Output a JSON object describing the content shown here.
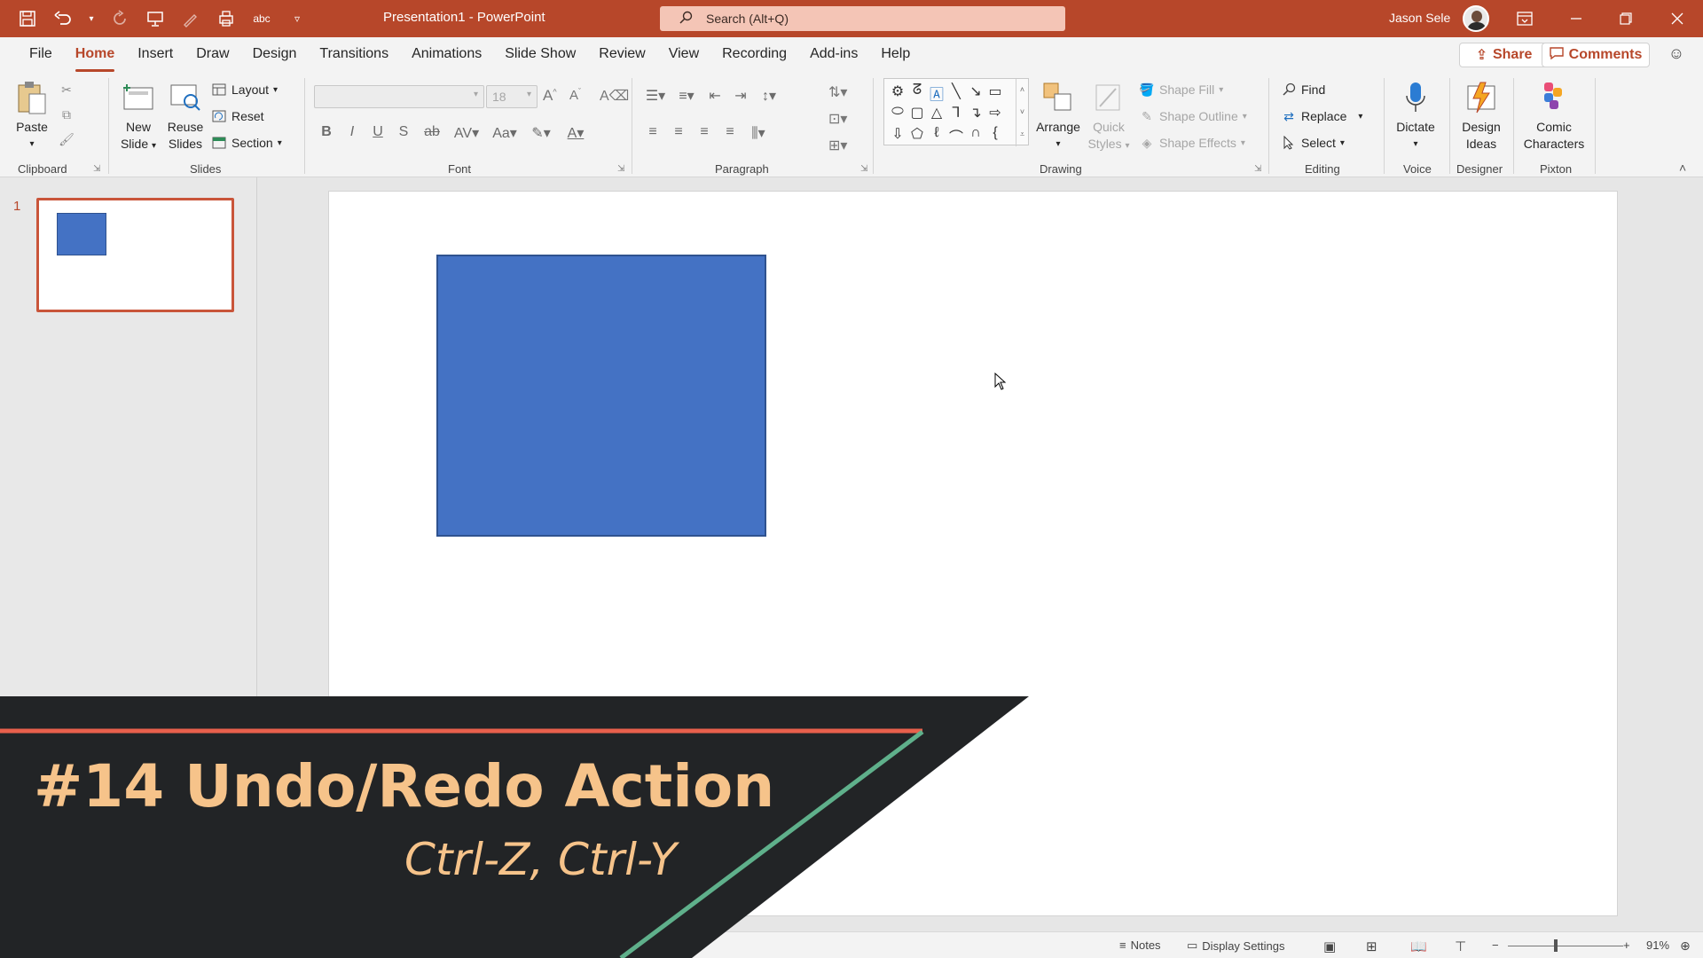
{
  "titlebar": {
    "document_title": "Presentation1  -  PowerPoint",
    "search_placeholder": "Search (Alt+Q)",
    "user_name": "Jason Sele"
  },
  "tabs": [
    "File",
    "Home",
    "Insert",
    "Draw",
    "Design",
    "Transitions",
    "Animations",
    "Slide Show",
    "Review",
    "View",
    "Recording",
    "Add-ins",
    "Help"
  ],
  "active_tab": "Home",
  "header_buttons": {
    "share": "Share",
    "comments": "Comments"
  },
  "ribbon": {
    "clipboard": {
      "label": "Clipboard",
      "paste": "Paste"
    },
    "slides": {
      "label": "Slides",
      "new_slide_1": "New",
      "new_slide_2": "Slide",
      "reuse_1": "Reuse",
      "reuse_2": "Slides",
      "layout": "Layout",
      "reset": "Reset",
      "section": "Section"
    },
    "font": {
      "label": "Font",
      "size": "18",
      "bold": "B",
      "italic": "I",
      "underline": "U",
      "shadow": "S",
      "strike": "ab",
      "case": "Aa"
    },
    "paragraph": {
      "label": "Paragraph"
    },
    "drawing": {
      "label": "Drawing",
      "arrange": "Arrange",
      "quick_1": "Quick",
      "quick_2": "Styles",
      "shape_fill": "Shape Fill",
      "shape_outline": "Shape Outline",
      "shape_effects": "Shape Effects"
    },
    "editing": {
      "label": "Editing",
      "find": "Find",
      "replace": "Replace",
      "select": "Select"
    },
    "voice": {
      "label": "Voice",
      "dictate": "Dictate"
    },
    "designer": {
      "label": "Designer",
      "design_1": "Design",
      "design_2": "Ideas"
    },
    "pixton": {
      "label": "Pixton",
      "comic_1": "Comic",
      "comic_2": "Characters"
    }
  },
  "thumbnails": {
    "slide_number": "1"
  },
  "statusbar": {
    "notes": "Notes",
    "display_settings": "Display Settings",
    "zoom": "91%",
    "zoom_minus": "−",
    "zoom_plus": "+"
  },
  "overlay": {
    "title": "#14 Undo/Redo Action",
    "subtitle": "Ctrl-Z, Ctrl-Y"
  },
  "colors": {
    "accent": "#b7472a",
    "shape_fill": "#4472c4",
    "banner_bg": "#222426",
    "banner_text": "#f6c38a",
    "banner_red_line": "#e8604c",
    "banner_green_line": "#5fb08b"
  }
}
